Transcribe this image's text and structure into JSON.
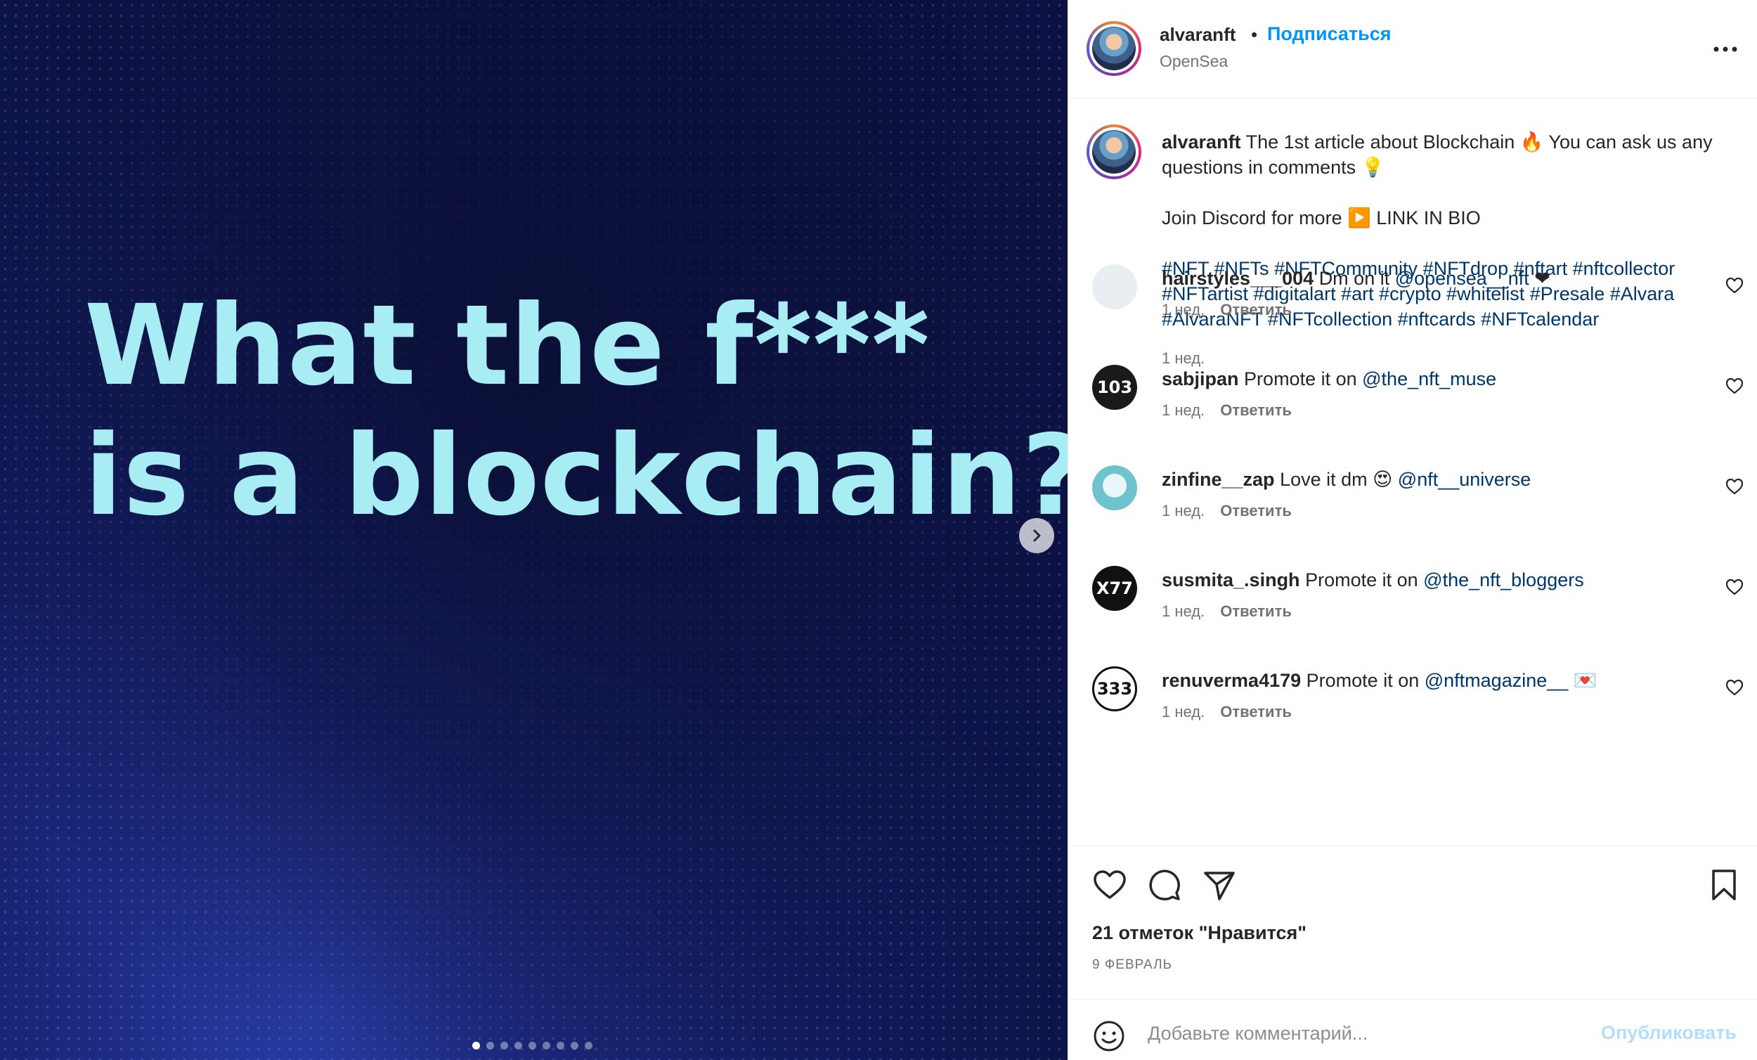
{
  "post": {
    "image_text_line1": "What the f***",
    "image_text_line2": "is a blockchain?",
    "carousel_total": 9,
    "carousel_active": 1
  },
  "header": {
    "username": "alvaranft",
    "separator": "•",
    "follow_label": "Подписаться",
    "location": "OpenSea"
  },
  "caption": {
    "username": "alvaranft",
    "line1": "The 1st article about Blockchain 🔥 You can ask us any questions in comments 💡",
    "line2": "Join Discord for more ▶️ LINK IN BIO",
    "tags": "#NFT #NFTs #NFTCommunity #NFTdrop #nftart #nftcollector #NFTartist #digitalart #art #crypto #whitelist #Presale #Alvara #AlvaraNFT #NFTcollection #nftcards #NFTcalendar",
    "time": "1 нед."
  },
  "comments": [
    {
      "username": "hairstyles___004",
      "text": "Dm on it",
      "mention": "@opensea__nft",
      "suffix": " ❤",
      "time": "1 нед.",
      "reply": "Ответить",
      "avatar_label": ""
    },
    {
      "username": "sabjipan",
      "text": "Promote it on",
      "mention": "@the_nft_muse",
      "suffix": "",
      "time": "1 нед.",
      "reply": "Ответить",
      "avatar_label": "103"
    },
    {
      "username": "zinfine__zap",
      "text": "Love it dm 😍",
      "mention": "@nft__universe",
      "suffix": "",
      "time": "1 нед.",
      "reply": "Ответить",
      "avatar_label": ""
    },
    {
      "username": "susmita_.singh",
      "text": "Promote it on",
      "mention": "@the_nft_bloggers",
      "suffix": "",
      "time": "1 нед.",
      "reply": "Ответить",
      "avatar_label": "X77"
    },
    {
      "username": "renuverma4179",
      "text": "Promote it on",
      "mention": "@nftmagazine__",
      "suffix": " 💌",
      "time": "1 нед.",
      "reply": "Ответить",
      "avatar_label": "333"
    }
  ],
  "actions": {
    "likes": "21 отметок \"Нравится\"",
    "date": "9 ФЕВРАЛЬ"
  },
  "add_comment": {
    "placeholder": "Добавьте комментарий...",
    "publish": "Опубликовать"
  },
  "colors": {
    "link": "#0095f6",
    "tag": "#00376b",
    "headline": "#a8ecf4",
    "media_bg": "#0d1447"
  }
}
